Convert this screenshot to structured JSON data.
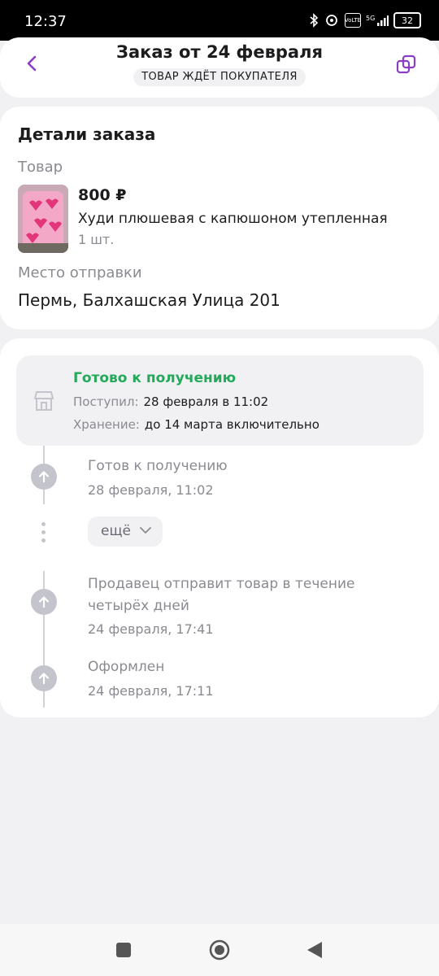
{
  "status_bar": {
    "time": "12:37",
    "battery": "32"
  },
  "header": {
    "title": "Заказ от 24 февраля",
    "status_pill": "ТОВАР ЖДЁТ ПОКУПАТЕЛЯ"
  },
  "order_details": {
    "heading": "Детали заказа",
    "item_label": "Товар",
    "price": "800 ₽",
    "item_name": "Худи плюшевая с капюшоном утепленная",
    "quantity": "1 шт.",
    "ship_from_label": "Место отправки",
    "ship_from": "Пермь, Балхашская Улица 201"
  },
  "pickup": {
    "title": "Готово к получению",
    "received_label": "Поступил:",
    "received_value": "28 февраля в 11:02",
    "storage_label": "Хранение:",
    "storage_value": "до 14 марта включительно"
  },
  "timeline": {
    "events": [
      {
        "title": "Готов к получению",
        "date": "28 февраля, 11:02"
      },
      {
        "title": "Продавец отправит товар в течение четырёх дней",
        "date": "24 февраля, 17:41"
      },
      {
        "title": "Оформлен",
        "date": "24 февраля, 17:11"
      }
    ],
    "more_label": "ещё"
  },
  "colors": {
    "accent": "#8a3ec8",
    "success": "#24a85a",
    "muted": "#8a8a91"
  },
  "icons": [
    "back-chevron-icon",
    "copy-icon",
    "store-icon",
    "arrow-up-icon",
    "chevron-down-icon"
  ]
}
